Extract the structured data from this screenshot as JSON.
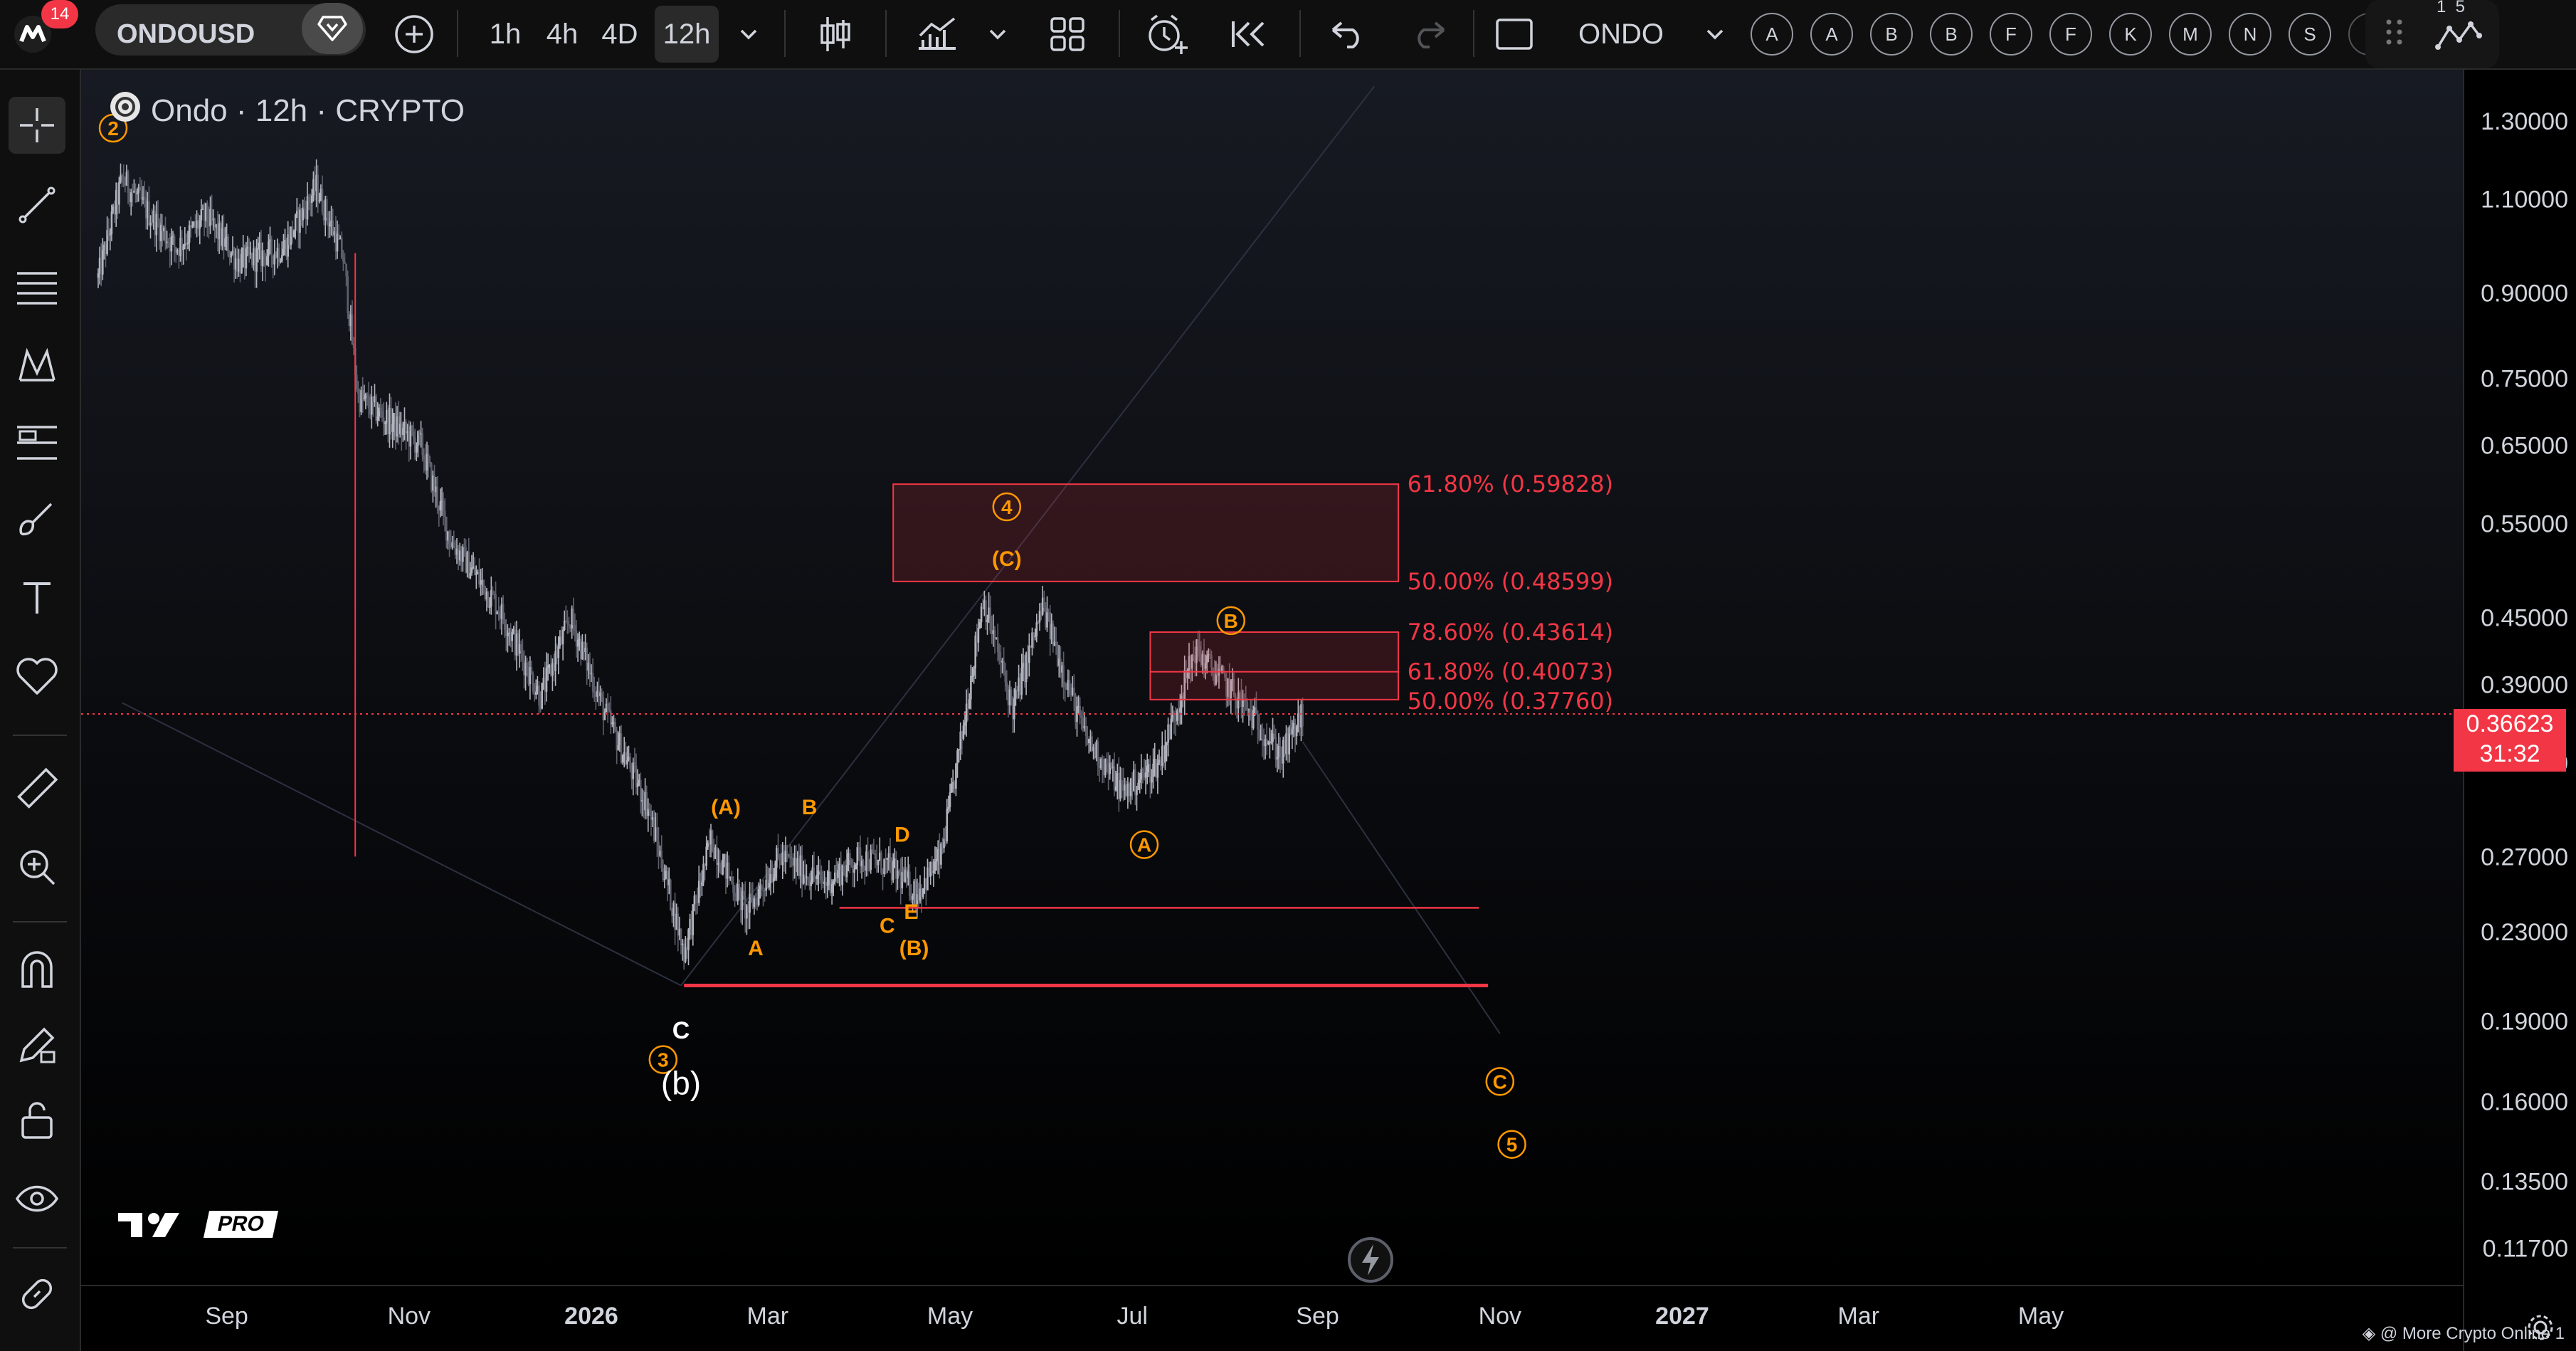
{
  "toolbar": {
    "notification_count": "14",
    "symbol": "ONDOUSD",
    "intervals": [
      "1h",
      "4h",
      "4D",
      "12h"
    ],
    "active_interval": "12h",
    "layout_name": "ONDO",
    "letter_buttons": [
      "A",
      "A",
      "B",
      "B",
      "F",
      "F",
      "K",
      "M",
      "N",
      "S"
    ],
    "corner_digits": "1  5"
  },
  "header": {
    "symbol_title": "Ondo · 12h · CRYPTO"
  },
  "price_axis": {
    "current_price": "0.36623",
    "countdown": "31:32",
    "partial_label": "0.33000",
    "tick_labels": [
      "1.30000",
      "1.10000",
      "0.90000",
      "0.75000",
      "0.65000",
      "0.55000",
      "0.45000",
      "0.39000",
      "0.27000",
      "0.23000",
      "0.19000",
      "0.16000",
      "0.13500",
      "0.11700"
    ]
  },
  "time_axis": {
    "labels": [
      "Sep",
      "Nov",
      "2026",
      "Mar",
      "May",
      "Jul",
      "Sep",
      "Nov",
      "2027",
      "Mar",
      "May"
    ]
  },
  "footer": {
    "logo_text": "PRO",
    "note": "@ More Crypto Online 1"
  },
  "colors": {
    "background": "#000000",
    "up_candle": "#b2b5be",
    "down_candle": "#5d606b",
    "fib": "#f23645",
    "wave": "#ff9800",
    "text": "#d1d4dc"
  },
  "chart_data": {
    "type": "candlestick",
    "symbol": "ONDOUSD",
    "interval": "12h",
    "exchange": "CRYPTO",
    "y_scale": "log",
    "ylim": [
      0.108,
      1.45
    ],
    "x_range": [
      "2025-07-20",
      "2027-06-30"
    ],
    "price_path": [
      [
        "2025-07-20",
        0.93
      ],
      [
        "2025-07-28",
        1.15
      ],
      [
        "2025-08-15",
        0.99
      ],
      [
        "2025-08-25",
        1.06
      ],
      [
        "2025-09-05",
        0.96
      ],
      [
        "2025-09-20",
        0.99
      ],
      [
        "2025-10-01",
        1.13
      ],
      [
        "2025-10-10",
        0.97
      ],
      [
        "2025-10-15",
        0.72
      ],
      [
        "2025-11-05",
        0.65
      ],
      [
        "2025-11-15",
        0.53
      ],
      [
        "2025-12-01",
        0.46
      ],
      [
        "2025-12-15",
        0.38
      ],
      [
        "2025-12-25",
        0.45
      ],
      [
        "2026-01-05",
        0.37
      ],
      [
        "2026-01-20",
        0.3
      ],
      [
        "2026-02-01",
        0.22
      ],
      [
        "2026-02-10",
        0.28
      ],
      [
        "2026-02-22",
        0.24
      ],
      [
        "2026-03-05",
        0.27
      ],
      [
        "2026-03-20",
        0.255
      ],
      [
        "2026-04-01",
        0.27
      ],
      [
        "2026-04-10",
        0.265
      ],
      [
        "2026-04-20",
        0.25
      ],
      [
        "2026-04-28",
        0.27
      ],
      [
        "2026-05-05",
        0.35
      ],
      [
        "2026-05-12",
        0.47
      ],
      [
        "2026-05-22",
        0.37
      ],
      [
        "2026-06-01",
        0.46
      ],
      [
        "2026-06-15",
        0.35
      ],
      [
        "2026-06-28",
        0.31
      ],
      [
        "2026-07-10",
        0.33
      ],
      [
        "2026-07-22",
        0.42
      ],
      [
        "2026-08-05",
        0.38
      ],
      [
        "2026-08-20",
        0.335
      ],
      [
        "2026-08-27",
        0.366
      ]
    ],
    "last_price": 0.36623,
    "fib_zones": [
      {
        "level": "61.80%",
        "price": 0.59828
      },
      {
        "level": "50.00%",
        "price": 0.48599
      },
      {
        "level": "78.60%",
        "price": 0.43614
      },
      {
        "level": "61.80%",
        "price": 0.40073
      },
      {
        "level": "50.00%",
        "price": 0.3776
      }
    ],
    "horizontal_lines": [
      {
        "price": 0.242,
        "from": "2026-03-25",
        "to": "2026-10-25"
      },
      {
        "price": 0.205,
        "from": "2026-02-01",
        "to": "2026-10-28"
      }
    ],
    "wave_labels": [
      {
        "text": "2",
        "style": "circled",
        "date": "2025-07-25",
        "price": 1.28
      },
      {
        "text": "(A)",
        "style": "plain",
        "date": "2026-02-15",
        "price": 0.3
      },
      {
        "text": "B",
        "style": "plain",
        "date": "2026-03-15",
        "price": 0.3
      },
      {
        "text": "A",
        "style": "plain",
        "date": "2026-02-25",
        "price": 0.222
      },
      {
        "text": "D",
        "style": "plain",
        "date": "2026-04-15",
        "price": 0.283
      },
      {
        "text": "C",
        "style": "plain",
        "date": "2026-04-10",
        "price": 0.233
      },
      {
        "text": "E",
        "style": "plain",
        "date": "2026-04-18",
        "price": 0.24
      },
      {
        "text": "(B)",
        "style": "plain",
        "date": "2026-04-19",
        "price": 0.222
      },
      {
        "text": "4",
        "style": "circled",
        "date": "2026-05-20",
        "price": 0.57
      },
      {
        "text": "(C)",
        "style": "plain",
        "date": "2026-05-20",
        "price": 0.51
      },
      {
        "text": "B",
        "style": "circled",
        "date": "2026-08-03",
        "price": 0.447
      },
      {
        "text": "A",
        "style": "circled",
        "date": "2026-07-05",
        "price": 0.277
      },
      {
        "text": "C",
        "style": "white",
        "date": "2026-01-31",
        "price": 0.187
      },
      {
        "text": "3",
        "style": "circled",
        "date": "2026-01-25",
        "price": 0.175
      },
      {
        "text": "(b)",
        "style": "white",
        "date": "2026-01-31",
        "price": 0.166
      },
      {
        "text": "C",
        "style": "circled",
        "date": "2026-11-01",
        "price": 0.167
      },
      {
        "text": "5",
        "style": "circled",
        "date": "2026-11-05",
        "price": 0.146
      }
    ]
  }
}
